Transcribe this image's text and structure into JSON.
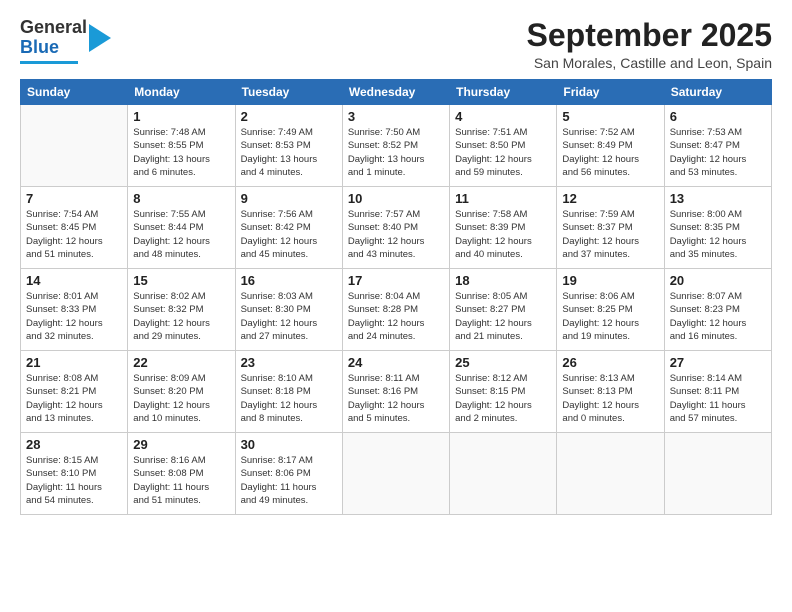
{
  "header": {
    "logo_general": "General",
    "logo_blue": "Blue",
    "month_title": "September 2025",
    "subtitle": "San Morales, Castille and Leon, Spain"
  },
  "days_header": [
    "Sunday",
    "Monday",
    "Tuesday",
    "Wednesday",
    "Thursday",
    "Friday",
    "Saturday"
  ],
  "weeks": [
    [
      {
        "day": "",
        "info": ""
      },
      {
        "day": "1",
        "info": "Sunrise: 7:48 AM\nSunset: 8:55 PM\nDaylight: 13 hours\nand 6 minutes."
      },
      {
        "day": "2",
        "info": "Sunrise: 7:49 AM\nSunset: 8:53 PM\nDaylight: 13 hours\nand 4 minutes."
      },
      {
        "day": "3",
        "info": "Sunrise: 7:50 AM\nSunset: 8:52 PM\nDaylight: 13 hours\nand 1 minute."
      },
      {
        "day": "4",
        "info": "Sunrise: 7:51 AM\nSunset: 8:50 PM\nDaylight: 12 hours\nand 59 minutes."
      },
      {
        "day": "5",
        "info": "Sunrise: 7:52 AM\nSunset: 8:49 PM\nDaylight: 12 hours\nand 56 minutes."
      },
      {
        "day": "6",
        "info": "Sunrise: 7:53 AM\nSunset: 8:47 PM\nDaylight: 12 hours\nand 53 minutes."
      }
    ],
    [
      {
        "day": "7",
        "info": "Sunrise: 7:54 AM\nSunset: 8:45 PM\nDaylight: 12 hours\nand 51 minutes."
      },
      {
        "day": "8",
        "info": "Sunrise: 7:55 AM\nSunset: 8:44 PM\nDaylight: 12 hours\nand 48 minutes."
      },
      {
        "day": "9",
        "info": "Sunrise: 7:56 AM\nSunset: 8:42 PM\nDaylight: 12 hours\nand 45 minutes."
      },
      {
        "day": "10",
        "info": "Sunrise: 7:57 AM\nSunset: 8:40 PM\nDaylight: 12 hours\nand 43 minutes."
      },
      {
        "day": "11",
        "info": "Sunrise: 7:58 AM\nSunset: 8:39 PM\nDaylight: 12 hours\nand 40 minutes."
      },
      {
        "day": "12",
        "info": "Sunrise: 7:59 AM\nSunset: 8:37 PM\nDaylight: 12 hours\nand 37 minutes."
      },
      {
        "day": "13",
        "info": "Sunrise: 8:00 AM\nSunset: 8:35 PM\nDaylight: 12 hours\nand 35 minutes."
      }
    ],
    [
      {
        "day": "14",
        "info": "Sunrise: 8:01 AM\nSunset: 8:33 PM\nDaylight: 12 hours\nand 32 minutes."
      },
      {
        "day": "15",
        "info": "Sunrise: 8:02 AM\nSunset: 8:32 PM\nDaylight: 12 hours\nand 29 minutes."
      },
      {
        "day": "16",
        "info": "Sunrise: 8:03 AM\nSunset: 8:30 PM\nDaylight: 12 hours\nand 27 minutes."
      },
      {
        "day": "17",
        "info": "Sunrise: 8:04 AM\nSunset: 8:28 PM\nDaylight: 12 hours\nand 24 minutes."
      },
      {
        "day": "18",
        "info": "Sunrise: 8:05 AM\nSunset: 8:27 PM\nDaylight: 12 hours\nand 21 minutes."
      },
      {
        "day": "19",
        "info": "Sunrise: 8:06 AM\nSunset: 8:25 PM\nDaylight: 12 hours\nand 19 minutes."
      },
      {
        "day": "20",
        "info": "Sunrise: 8:07 AM\nSunset: 8:23 PM\nDaylight: 12 hours\nand 16 minutes."
      }
    ],
    [
      {
        "day": "21",
        "info": "Sunrise: 8:08 AM\nSunset: 8:21 PM\nDaylight: 12 hours\nand 13 minutes."
      },
      {
        "day": "22",
        "info": "Sunrise: 8:09 AM\nSunset: 8:20 PM\nDaylight: 12 hours\nand 10 minutes."
      },
      {
        "day": "23",
        "info": "Sunrise: 8:10 AM\nSunset: 8:18 PM\nDaylight: 12 hours\nand 8 minutes."
      },
      {
        "day": "24",
        "info": "Sunrise: 8:11 AM\nSunset: 8:16 PM\nDaylight: 12 hours\nand 5 minutes."
      },
      {
        "day": "25",
        "info": "Sunrise: 8:12 AM\nSunset: 8:15 PM\nDaylight: 12 hours\nand 2 minutes."
      },
      {
        "day": "26",
        "info": "Sunrise: 8:13 AM\nSunset: 8:13 PM\nDaylight: 12 hours\nand 0 minutes."
      },
      {
        "day": "27",
        "info": "Sunrise: 8:14 AM\nSunset: 8:11 PM\nDaylight: 11 hours\nand 57 minutes."
      }
    ],
    [
      {
        "day": "28",
        "info": "Sunrise: 8:15 AM\nSunset: 8:10 PM\nDaylight: 11 hours\nand 54 minutes."
      },
      {
        "day": "29",
        "info": "Sunrise: 8:16 AM\nSunset: 8:08 PM\nDaylight: 11 hours\nand 51 minutes."
      },
      {
        "day": "30",
        "info": "Sunrise: 8:17 AM\nSunset: 8:06 PM\nDaylight: 11 hours\nand 49 minutes."
      },
      {
        "day": "",
        "info": ""
      },
      {
        "day": "",
        "info": ""
      },
      {
        "day": "",
        "info": ""
      },
      {
        "day": "",
        "info": ""
      }
    ]
  ]
}
